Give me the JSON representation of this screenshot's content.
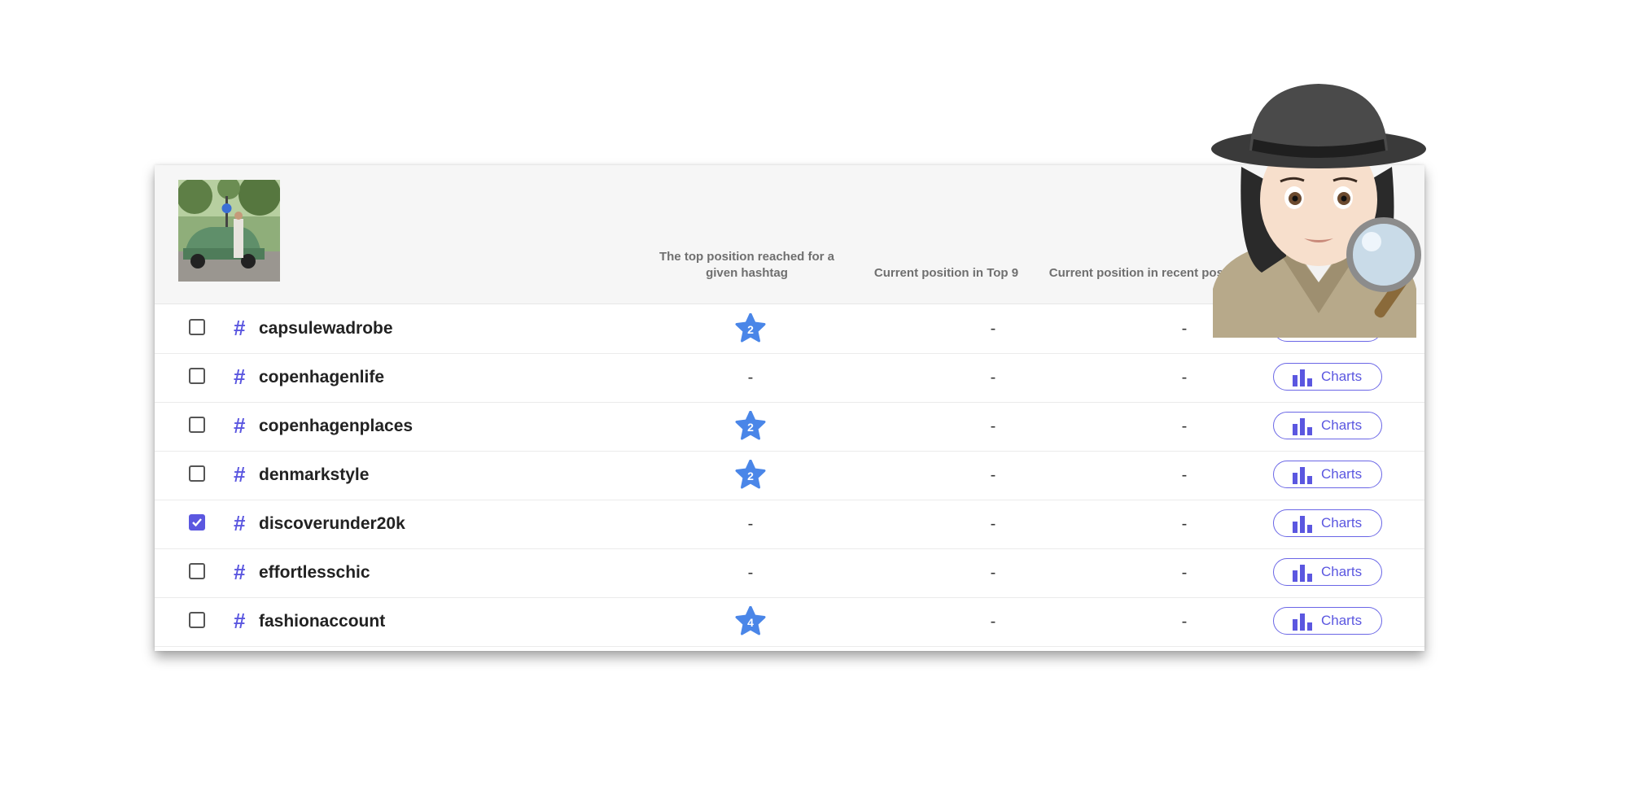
{
  "header": {
    "col_top_position": "The top position reached for a given hashtag",
    "col_top9": "Current position in Top 9",
    "col_recent": "Current position in recent posts"
  },
  "rows": [
    {
      "hashtag": "capsulewadrobe",
      "top_position": "2",
      "checked": false,
      "top9": "-",
      "recent": "-",
      "charts_label": "Charts"
    },
    {
      "hashtag": "copenhagenlife",
      "top_position": "-",
      "checked": false,
      "top9": "-",
      "recent": "-",
      "charts_label": "Charts"
    },
    {
      "hashtag": "copenhagenplaces",
      "top_position": "2",
      "checked": false,
      "top9": "-",
      "recent": "-",
      "charts_label": "Charts"
    },
    {
      "hashtag": "denmarkstyle",
      "top_position": "2",
      "checked": false,
      "top9": "-",
      "recent": "-",
      "charts_label": "Charts"
    },
    {
      "hashtag": "discoverunder20k",
      "top_position": "-",
      "checked": true,
      "top9": "-",
      "recent": "-",
      "charts_label": "Charts"
    },
    {
      "hashtag": "effortlesschic",
      "top_position": "-",
      "checked": false,
      "top9": "-",
      "recent": "-",
      "charts_label": "Charts"
    },
    {
      "hashtag": "fashionaccount",
      "top_position": "4",
      "checked": false,
      "top9": "-",
      "recent": "-",
      "charts_label": "Charts"
    }
  ],
  "hash_symbol": "#",
  "colors": {
    "accent": "#5b57e0",
    "star": "#4a86e8",
    "header_bg": "#f6f6f6"
  },
  "icons": {
    "checkbox": "checkbox-icon",
    "chart": "bar-chart-icon",
    "star": "star-badge-icon",
    "overlay": "detective-emoji"
  }
}
